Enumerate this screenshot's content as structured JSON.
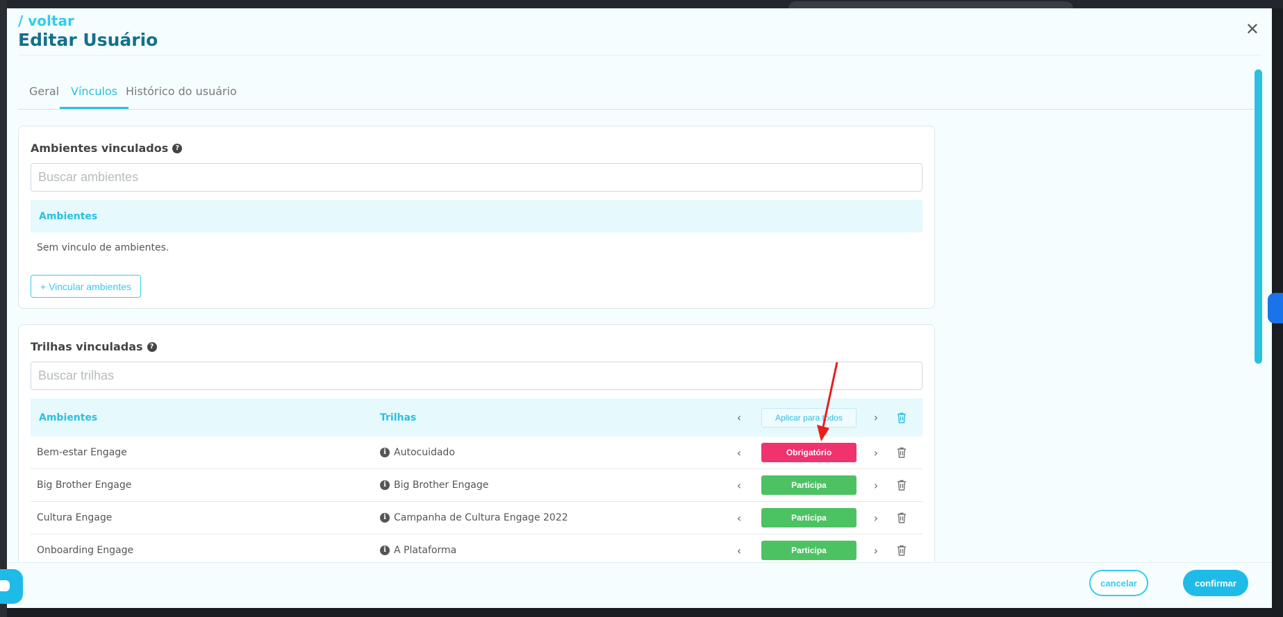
{
  "header": {
    "breadcrumb": "/ voltar",
    "title": "Editar Usuário"
  },
  "tabs": [
    {
      "label": "Geral",
      "active": false
    },
    {
      "label": "Vínculos",
      "active": true
    },
    {
      "label": "Histórico do usuário",
      "active": false
    }
  ],
  "ambientes": {
    "title": "Ambientes vinculados",
    "search_placeholder": "Buscar ambientes",
    "column_header": "Ambientes",
    "empty_message": "Sem vinculo de ambientes.",
    "add_button": "+ Vincular ambientes"
  },
  "trilhas": {
    "title": "Trilhas vinculadas",
    "search_placeholder": "Buscar trilhas",
    "columns": {
      "ambientes": "Ambientes",
      "trilhas": "Trilhas",
      "apply_all": "Aplicar para todos"
    },
    "rows": [
      {
        "ambiente": "Bem-estar Engage",
        "trilha": "Autocuidado",
        "status": "Obrigatório"
      },
      {
        "ambiente": "Big Brother Engage",
        "trilha": "Big Brother Engage",
        "status": "Participa"
      },
      {
        "ambiente": "Cultura Engage",
        "trilha": "Campanha de Cultura Engage 2022",
        "status": "Participa"
      },
      {
        "ambiente": "Onboarding Engage",
        "trilha": "A Plataforma",
        "status": "Participa"
      }
    ]
  },
  "footer": {
    "cancel": "cancelar",
    "confirm": "confirmar"
  },
  "icons": {
    "close": "close-icon",
    "help": "help-icon",
    "info": "info-icon",
    "chevron_left": "chevron-left-icon",
    "chevron_right": "chevron-right-icon",
    "trash": "trash-icon"
  },
  "colors": {
    "accent": "#2bbfe0",
    "title": "#13708c",
    "obrigatorio": "#f0326e",
    "participa": "#4cc263"
  }
}
